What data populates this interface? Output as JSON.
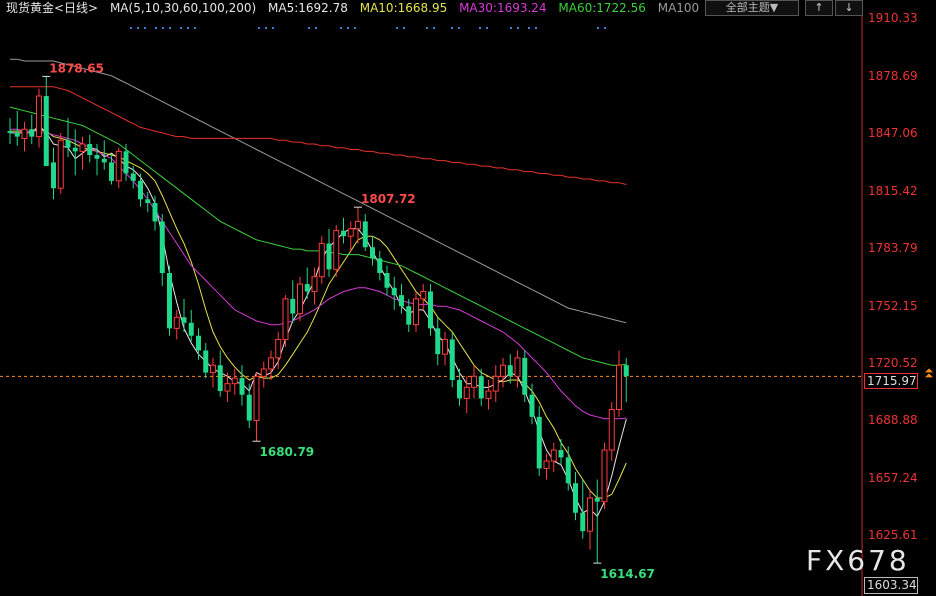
{
  "header": {
    "instrument": "现货黄金<日线>",
    "ma_set": "MA(5,10,30,60,100,200)",
    "ma_values": [
      {
        "text": "MA5:1692.78",
        "color": "#e8e8e8"
      },
      {
        "text": "MA10:1668.95",
        "color": "#e6e34a"
      },
      {
        "text": "MA30:1693.24",
        "color": "#d63cd6"
      },
      {
        "text": "MA60:1722.56",
        "color": "#3bd13b"
      },
      {
        "text": "MA100",
        "color": "#9a9a9a"
      }
    ],
    "menu_label": "全部主题▼",
    "tool_buttons": [
      "↑",
      "↓"
    ]
  },
  "colors": {
    "up": "#ff3b3b",
    "down": "#21d98a",
    "ma5": "#e8e8e8",
    "ma10": "#e6e34a",
    "ma30": "#d63cd6",
    "ma60": "#3bd13b",
    "ma100": "#9a9a9a",
    "ma200": "#e8312b",
    "axis": "#cc2a2a",
    "current": "#ff8c1a",
    "dots": "#3a7fd6"
  },
  "axis_ticks": [
    "1910.33",
    "1878.69",
    "1847.06",
    "1815.42",
    "1783.79",
    "1752.15",
    "1720.52",
    "1688.88",
    "1657.24",
    "1625.61"
  ],
  "current_price": "1715.97",
  "bottom_price": "1603.34",
  "watermark": "FX678",
  "chart_data": {
    "type": "candlestick",
    "title": "现货黄金<日线>",
    "ylim": [
      1603.34,
      1913.0
    ],
    "annotations": [
      {
        "text": "1878.65",
        "index": 5,
        "value": 1878.65,
        "kind": "high"
      },
      {
        "text": "1807.72",
        "index": 48,
        "value": 1807.72,
        "kind": "high"
      },
      {
        "text": "1680.79",
        "index": 34,
        "value": 1680.79,
        "kind": "low"
      },
      {
        "text": "1614.67",
        "index": 81,
        "value": 1614.67,
        "kind": "low"
      }
    ],
    "candles": [
      [
        1849,
        1856,
        1842,
        1848
      ],
      [
        1848,
        1860,
        1841,
        1846
      ],
      [
        1845,
        1854,
        1838,
        1850
      ],
      [
        1850,
        1858,
        1842,
        1846
      ],
      [
        1846,
        1872,
        1840,
        1868
      ],
      [
        1868,
        1878.65,
        1852,
        1830
      ],
      [
        1832,
        1840,
        1812,
        1818
      ],
      [
        1818,
        1848,
        1815,
        1844
      ],
      [
        1844,
        1856,
        1835,
        1840
      ],
      [
        1840,
        1850,
        1825,
        1838
      ],
      [
        1838,
        1846,
        1828,
        1842
      ],
      [
        1842,
        1847,
        1832,
        1836
      ],
      [
        1836,
        1842,
        1825,
        1834
      ],
      [
        1834,
        1844,
        1828,
        1832
      ],
      [
        1832,
        1836,
        1820,
        1822
      ],
      [
        1822,
        1840,
        1818,
        1838
      ],
      [
        1838,
        1842,
        1822,
        1826
      ],
      [
        1826,
        1830,
        1818,
        1822
      ],
      [
        1822,
        1826,
        1808,
        1812
      ],
      [
        1812,
        1816,
        1805,
        1810
      ],
      [
        1810,
        1814,
        1795,
        1800
      ],
      [
        1800,
        1804,
        1765,
        1772
      ],
      [
        1772,
        1776,
        1738,
        1742
      ],
      [
        1742,
        1752,
        1736,
        1748
      ],
      [
        1748,
        1758,
        1740,
        1745
      ],
      [
        1745,
        1752,
        1735,
        1738
      ],
      [
        1738,
        1742,
        1725,
        1730
      ],
      [
        1730,
        1734,
        1715,
        1718
      ],
      [
        1718,
        1726,
        1710,
        1722
      ],
      [
        1722,
        1730,
        1705,
        1708
      ],
      [
        1708,
        1718,
        1702,
        1712
      ],
      [
        1712,
        1720,
        1706,
        1715
      ],
      [
        1715,
        1722,
        1700,
        1706
      ],
      [
        1706,
        1712,
        1688,
        1692
      ],
      [
        1692,
        1718,
        1680.79,
        1716
      ],
      [
        1716,
        1724,
        1710,
        1720
      ],
      [
        1720,
        1730,
        1714,
        1726
      ],
      [
        1726,
        1740,
        1720,
        1736
      ],
      [
        1736,
        1760,
        1732,
        1758
      ],
      [
        1758,
        1768,
        1745,
        1750
      ],
      [
        1750,
        1770,
        1746,
        1766
      ],
      [
        1766,
        1775,
        1758,
        1762
      ],
      [
        1762,
        1775,
        1755,
        1770
      ],
      [
        1770,
        1792,
        1766,
        1788
      ],
      [
        1788,
        1796,
        1770,
        1774
      ],
      [
        1774,
        1798,
        1770,
        1795
      ],
      [
        1795,
        1802,
        1788,
        1792
      ],
      [
        1792,
        1800,
        1784,
        1796
      ],
      [
        1796,
        1807.72,
        1788,
        1800
      ],
      [
        1800,
        1804,
        1784,
        1786
      ],
      [
        1786,
        1792,
        1776,
        1780
      ],
      [
        1780,
        1784,
        1768,
        1772
      ],
      [
        1772,
        1776,
        1760,
        1764
      ],
      [
        1764,
        1770,
        1752,
        1760
      ],
      [
        1760,
        1766,
        1750,
        1754
      ],
      [
        1754,
        1758,
        1740,
        1744
      ],
      [
        1744,
        1762,
        1740,
        1758
      ],
      [
        1758,
        1766,
        1752,
        1762
      ],
      [
        1762,
        1766,
        1738,
        1742
      ],
      [
        1742,
        1748,
        1722,
        1728
      ],
      [
        1728,
        1740,
        1722,
        1736
      ],
      [
        1736,
        1740,
        1710,
        1714
      ],
      [
        1714,
        1720,
        1700,
        1704
      ],
      [
        1704,
        1716,
        1696,
        1710
      ],
      [
        1710,
        1722,
        1704,
        1716
      ],
      [
        1716,
        1720,
        1700,
        1704
      ],
      [
        1704,
        1714,
        1698,
        1708
      ],
      [
        1708,
        1722,
        1702,
        1716
      ],
      [
        1716,
        1726,
        1710,
        1722
      ],
      [
        1722,
        1728,
        1712,
        1716
      ],
      [
        1716,
        1730,
        1710,
        1726
      ],
      [
        1726,
        1730,
        1702,
        1706
      ],
      [
        1706,
        1712,
        1690,
        1694
      ],
      [
        1694,
        1700,
        1662,
        1666
      ],
      [
        1666,
        1674,
        1660,
        1670
      ],
      [
        1670,
        1680,
        1664,
        1676
      ],
      [
        1676,
        1682,
        1668,
        1672
      ],
      [
        1672,
        1678,
        1654,
        1658
      ],
      [
        1658,
        1664,
        1638,
        1642
      ],
      [
        1642,
        1660,
        1628,
        1632
      ],
      [
        1632,
        1654,
        1622,
        1650
      ],
      [
        1650,
        1660,
        1614.67,
        1648
      ],
      [
        1648,
        1680,
        1644,
        1676
      ],
      [
        1676,
        1702,
        1670,
        1698
      ],
      [
        1698,
        1730,
        1694,
        1722
      ],
      [
        1722,
        1726,
        1702,
        1716
      ]
    ],
    "moving_averages": [
      {
        "name": "MA5",
        "values": [
          1848,
          1848,
          1848,
          1848,
          1852,
          1848,
          1842,
          1841,
          1840,
          1834,
          1837,
          1840,
          1839,
          1835,
          1837,
          1834,
          1830,
          1828,
          1824,
          1818,
          1810,
          1792,
          1772,
          1756,
          1742,
          1734,
          1728,
          1724,
          1720,
          1718,
          1716,
          1713,
          1712,
          1708,
          1718,
          1716,
          1718,
          1724,
          1736,
          1746,
          1752,
          1760,
          1768,
          1780,
          1786,
          1790,
          1794,
          1796,
          1796,
          1791,
          1784,
          1776,
          1768,
          1762,
          1754,
          1750,
          1752,
          1752,
          1746,
          1738,
          1734,
          1726,
          1718,
          1712,
          1712,
          1710,
          1710,
          1712,
          1714,
          1718,
          1716,
          1708,
          1698,
          1686,
          1676,
          1670,
          1668,
          1660,
          1650,
          1642,
          1644,
          1640,
          1648,
          1662,
          1678,
          1692.78
        ]
      },
      {
        "name": "MA10",
        "values": [
          1849,
          1849,
          1849,
          1849,
          1850,
          1849,
          1846,
          1845,
          1844,
          1842,
          1840,
          1839,
          1838,
          1837,
          1836,
          1835,
          1833,
          1831,
          1829,
          1826,
          1822,
          1814,
          1805,
          1796,
          1788,
          1778,
          1766,
          1752,
          1740,
          1732,
          1726,
          1721,
          1717,
          1714,
          1716,
          1715,
          1715,
          1717,
          1722,
          1728,
          1734,
          1740,
          1748,
          1757,
          1766,
          1772,
          1778,
          1784,
          1790,
          1792,
          1792,
          1790,
          1786,
          1780,
          1774,
          1768,
          1762,
          1758,
          1754,
          1748,
          1744,
          1740,
          1734,
          1728,
          1722,
          1718,
          1716,
          1714,
          1713,
          1714,
          1714,
          1712,
          1708,
          1702,
          1694,
          1688,
          1680,
          1674,
          1666,
          1660,
          1654,
          1650,
          1650,
          1652,
          1660,
          1668.95
        ]
      },
      {
        "name": "MA30",
        "values": [
          1850,
          1850,
          1849,
          1849,
          1849,
          1848,
          1847,
          1846,
          1845,
          1844,
          1842,
          1840,
          1838,
          1836,
          1834,
          1830,
          1826,
          1822,
          1817,
          1812,
          1806,
          1800,
          1794,
          1788,
          1782,
          1776,
          1772,
          1768,
          1764,
          1760,
          1756,
          1752,
          1750,
          1748,
          1746,
          1745,
          1744,
          1744,
          1745,
          1746,
          1748,
          1750,
          1752,
          1755,
          1758,
          1760,
          1762,
          1763,
          1764,
          1764,
          1763,
          1762,
          1760,
          1758,
          1757,
          1756,
          1755,
          1755,
          1755,
          1754,
          1754,
          1753,
          1752,
          1750,
          1748,
          1746,
          1744,
          1742,
          1740,
          1737,
          1734,
          1730,
          1726,
          1722,
          1718,
          1713,
          1708,
          1704,
          1700,
          1697,
          1695,
          1694,
          1693,
          1693,
          1693,
          1693.24
        ]
      },
      {
        "name": "MA60",
        "values": [
          1862,
          1861,
          1860,
          1859,
          1858,
          1857,
          1856,
          1855,
          1854,
          1853,
          1852,
          1850,
          1848,
          1846,
          1844,
          1842,
          1839,
          1836,
          1833,
          1830,
          1827,
          1824,
          1821,
          1818,
          1815,
          1812,
          1809,
          1806,
          1803,
          1800,
          1798,
          1796,
          1794,
          1792,
          1790,
          1789,
          1788,
          1787,
          1786,
          1785,
          1785,
          1784,
          1784,
          1784,
          1783,
          1783,
          1782,
          1782,
          1782,
          1781,
          1780,
          1779,
          1778,
          1777,
          1776,
          1774,
          1772,
          1770,
          1768,
          1766,
          1764,
          1762,
          1760,
          1758,
          1756,
          1754,
          1752,
          1750,
          1748,
          1746,
          1744,
          1742,
          1740,
          1738,
          1736,
          1734,
          1732,
          1730,
          1728,
          1726,
          1725,
          1724,
          1723,
          1722,
          1722,
          1722.56
        ]
      },
      {
        "name": "MA100",
        "values": [
          1888,
          1888,
          1887,
          1887,
          1887,
          1887,
          1887,
          1886,
          1885,
          1884,
          1883,
          1882,
          1881,
          1880,
          1879,
          1877,
          1875,
          1873,
          1871,
          1869,
          1867,
          1865,
          1863,
          1861,
          1859,
          1857,
          1855,
          1853,
          1851,
          1849,
          1847,
          1845,
          1843,
          1841,
          1839,
          1837,
          1835,
          1833,
          1831,
          1829,
          1827,
          1825,
          1823,
          1821,
          1819,
          1817,
          1815,
          1813,
          1811,
          1809,
          1807,
          1805,
          1803,
          1801,
          1799,
          1797,
          1795,
          1793,
          1791,
          1789,
          1787,
          1785,
          1783,
          1781,
          1779,
          1777,
          1775,
          1773,
          1771,
          1769,
          1767,
          1765,
          1763,
          1761,
          1759,
          1757,
          1755,
          1753,
          1752,
          1751,
          1750,
          1749,
          1748,
          1747,
          1746,
          1745
        ]
      },
      {
        "name": "MA200",
        "values": [
          1873,
          1873,
          1873,
          1873,
          1873,
          1873,
          1873,
          1872,
          1871,
          1869,
          1867,
          1865,
          1863,
          1861,
          1859,
          1857,
          1855,
          1853,
          1851,
          1850,
          1849,
          1848,
          1847,
          1846,
          1846,
          1845,
          1845,
          1845,
          1845,
          1845,
          1845,
          1845,
          1845,
          1845,
          1845,
          1845,
          1845,
          1844,
          1844,
          1843,
          1843,
          1842,
          1842,
          1841,
          1841,
          1840,
          1840,
          1839,
          1839,
          1838,
          1838,
          1837,
          1837,
          1836,
          1836,
          1835,
          1835,
          1834,
          1834,
          1833,
          1833,
          1832,
          1832,
          1831,
          1831,
          1830,
          1830,
          1829,
          1829,
          1828,
          1828,
          1827,
          1827,
          1826,
          1826,
          1825,
          1825,
          1824,
          1824,
          1823,
          1823,
          1822,
          1822,
          1821,
          1821,
          1820
        ]
      }
    ]
  }
}
